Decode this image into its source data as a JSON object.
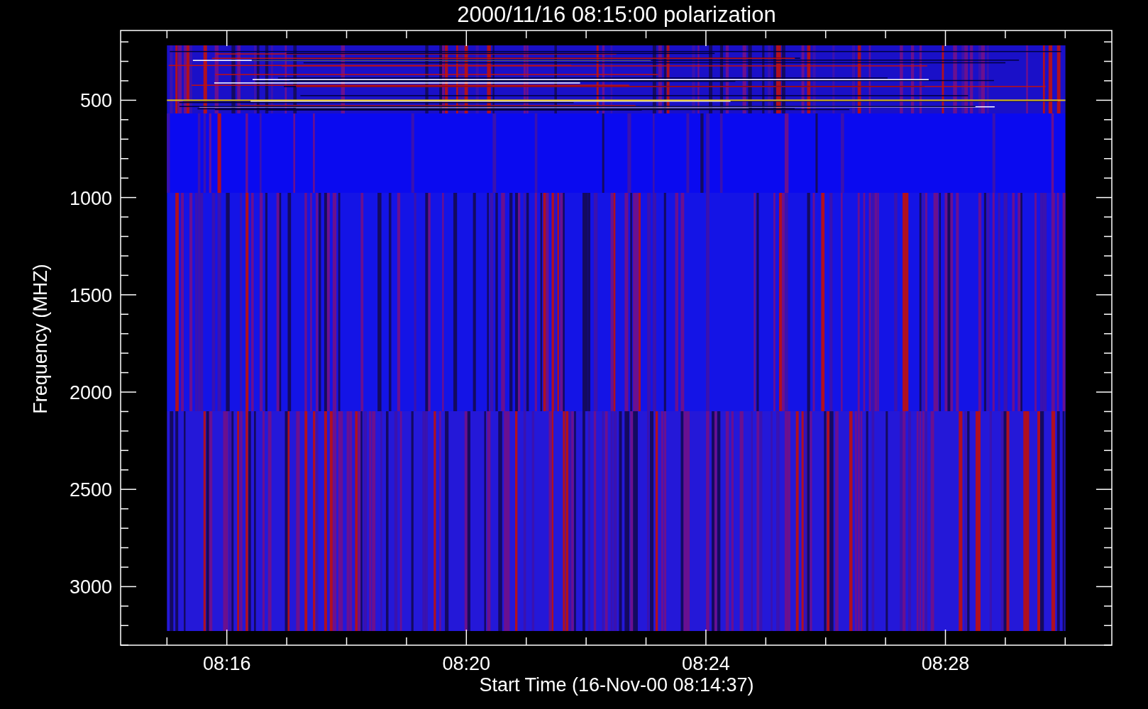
{
  "title": "2000/11/16 08:15:00 polarization",
  "y_axis": {
    "label": "Frequency (MHZ)",
    "ticks": [
      "500",
      "1000",
      "1500",
      "2000",
      "2500",
      "3000"
    ]
  },
  "x_axis": {
    "label": "Start Time (16-Nov-00 08:14:37)",
    "ticks": [
      "08:16",
      "08:20",
      "08:24",
      "08:28"
    ]
  }
}
